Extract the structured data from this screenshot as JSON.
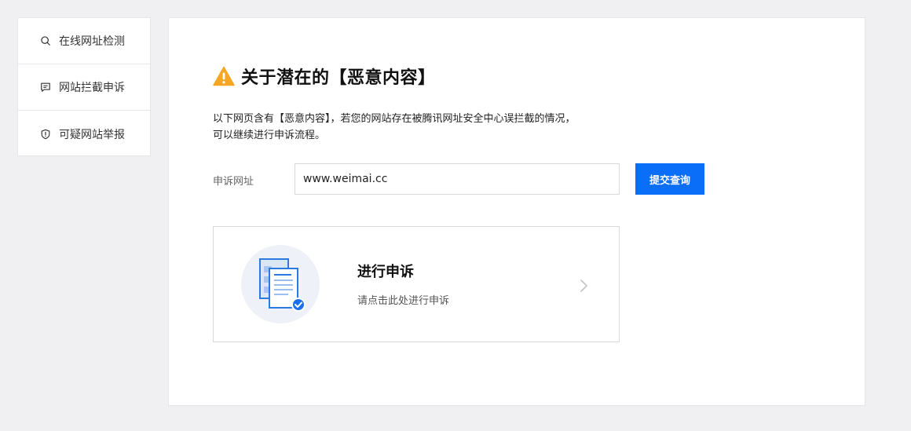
{
  "sidebar": {
    "items": [
      {
        "label": "在线网址检测",
        "icon": "search-icon"
      },
      {
        "label": "网站拦截申诉",
        "icon": "message-icon"
      },
      {
        "label": "可疑网站举报",
        "icon": "shield-icon"
      }
    ]
  },
  "main": {
    "title": "关于潜在的【恶意内容】",
    "warning_icon": "warning-icon",
    "desc_line1": "以下网页含有【恶意内容】，若您的网站存在被腾讯网址安全中心误拦截的情况，",
    "desc_line2": "可以继续进行申诉流程。",
    "url_label": "申诉网址",
    "url_value": "www.weimai.cc",
    "submit_label": "提交查询",
    "appeal": {
      "title": "进行申诉",
      "subtitle": "请点击此处进行申诉",
      "icon": "document-check-icon"
    }
  },
  "colors": {
    "accent": "#0a6ef8",
    "warning": "#f5a623",
    "background": "#f0f0f3"
  }
}
